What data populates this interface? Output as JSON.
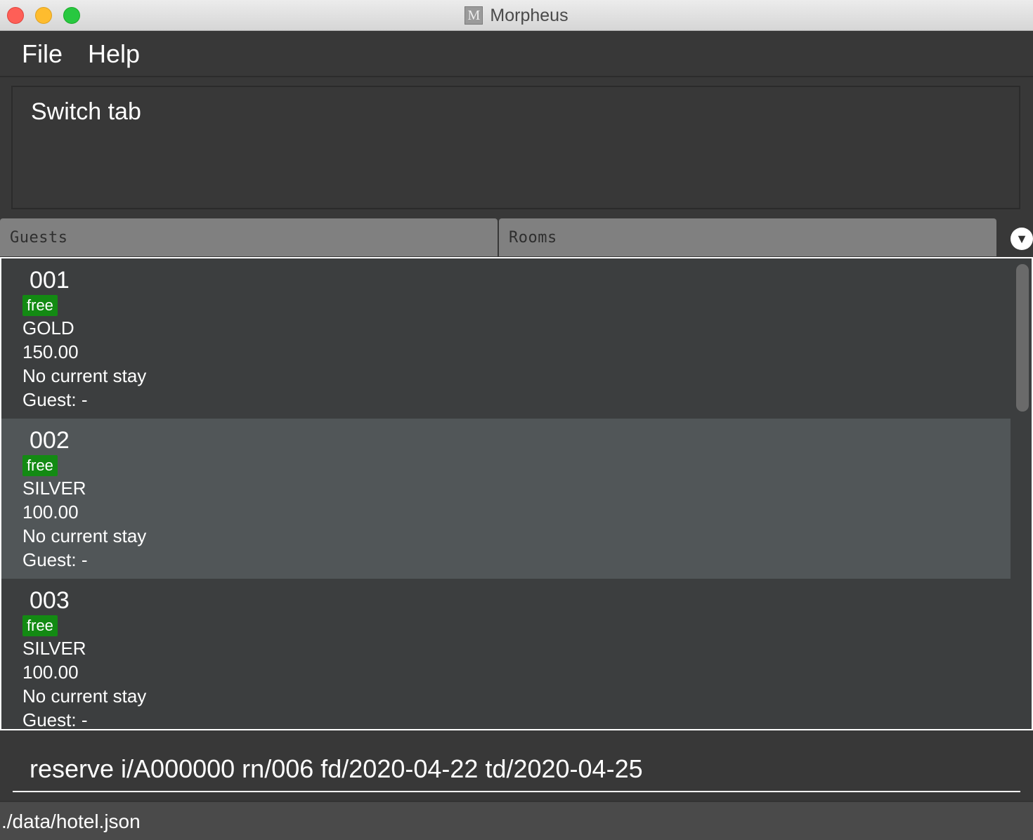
{
  "window": {
    "title": "Morpheus",
    "icon_letter": "M"
  },
  "menu": {
    "items": [
      {
        "label": "File"
      },
      {
        "label": "Help"
      }
    ]
  },
  "result": {
    "text": "Switch tab"
  },
  "tabs": [
    {
      "label": "Guests"
    },
    {
      "label": "Rooms"
    }
  ],
  "rooms": [
    {
      "number": "001",
      "status": "free",
      "tier": "GOLD",
      "price": "150.00",
      "stay": "No current stay",
      "guest": "Guest: -"
    },
    {
      "number": "002",
      "status": "free",
      "tier": "SILVER",
      "price": "100.00",
      "stay": "No current stay",
      "guest": "Guest: -"
    },
    {
      "number": "003",
      "status": "free",
      "tier": "SILVER",
      "price": "100.00",
      "stay": "No current stay",
      "guest": "Guest: -"
    }
  ],
  "command": {
    "value": "reserve i/A000000 rn/006 fd/2020-04-22 td/2020-04-25"
  },
  "status": {
    "path": "./data/hotel.json"
  },
  "colors": {
    "free_badge": "#138a13",
    "selected_row": "#515658"
  }
}
